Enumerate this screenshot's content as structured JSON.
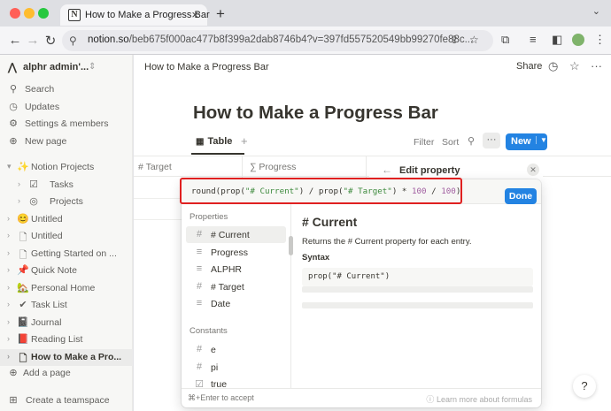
{
  "browser": {
    "tab_title": "How to Make a Progress Bar",
    "tab_favicon": "N",
    "url_host": "notion.so",
    "url_path": "/beb675f000ac477b8f399a2dab8746b4?v=397fd557520549bb99270fe88c..."
  },
  "sidebar": {
    "workspace": "alphr admin'...",
    "nav": [
      {
        "label": "Search",
        "icon": "search-icon"
      },
      {
        "label": "Updates",
        "icon": "clock-icon"
      },
      {
        "label": "Settings & members",
        "icon": "gear-icon"
      },
      {
        "label": "New page",
        "icon": "plus-circle-icon"
      }
    ],
    "pages": [
      {
        "label": "Notion Projects",
        "icon": "✨",
        "chev": "▾"
      },
      {
        "label": "Tasks",
        "icon": "☑",
        "chev": "›",
        "indent": true
      },
      {
        "label": "Projects",
        "icon": "◎",
        "chev": "›",
        "indent": true
      },
      {
        "label": "Untitled",
        "icon": "😊",
        "chev": "›"
      },
      {
        "label": "Untitled",
        "icon": "🗋",
        "chev": "›"
      },
      {
        "label": "Getting Started on ...",
        "icon": "🗋",
        "chev": "›"
      },
      {
        "label": "Quick Note",
        "icon": "📌",
        "chev": "›"
      },
      {
        "label": "Personal Home",
        "icon": "🏡",
        "chev": "›"
      },
      {
        "label": "Task List",
        "icon": "✔",
        "chev": "›"
      },
      {
        "label": "Journal",
        "icon": "📓",
        "chev": "›"
      },
      {
        "label": "Reading List",
        "icon": "📕",
        "chev": "›"
      },
      {
        "label": "How to Make a Pro...",
        "icon": "🗋",
        "chev": "›",
        "selected": true
      }
    ],
    "add_page": "Add a page",
    "create_teamspace": "Create a teamspace"
  },
  "main": {
    "breadcrumb": "How to Make a Progress Bar",
    "share": "Share",
    "title": "How to Make a Progress Bar",
    "view_tab": "Table",
    "filter": "Filter",
    "sort": "Sort",
    "more": "···",
    "new_button": "New",
    "columns": [
      "# Target",
      "∑ Progress"
    ],
    "edit_property_title": "Edit property"
  },
  "formula_editor": {
    "done": "Done",
    "properties_heading": "Properties",
    "properties": [
      {
        "icon": "#",
        "label": "# Current",
        "selected": true
      },
      {
        "icon": "≡",
        "label": "Progress"
      },
      {
        "icon": "≡",
        "label": "ALPHR"
      },
      {
        "icon": "#",
        "label": "# Target"
      },
      {
        "icon": "≡",
        "label": "Date"
      }
    ],
    "constants_heading": "Constants",
    "constants": [
      {
        "icon": "#",
        "label": "e"
      },
      {
        "icon": "#",
        "label": "pi"
      },
      {
        "icon": "☑",
        "label": "true"
      }
    ],
    "detail_title": "# Current",
    "detail_desc": "Returns the # Current property for each entry.",
    "syntax_heading": "Syntax",
    "syntax_code": "prop(\"# Current\")",
    "footer_hint": "⌘+Enter to accept",
    "footer_learn": "Learn more about formulas"
  },
  "help": "?"
}
